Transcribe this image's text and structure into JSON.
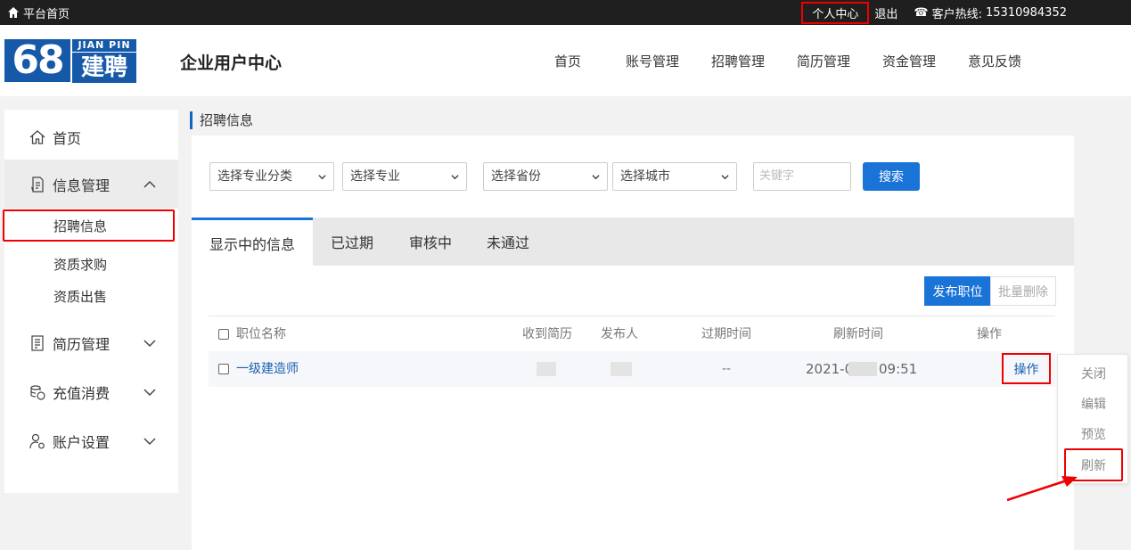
{
  "topbar": {
    "home_label": "平台首页",
    "personal_center": "个人中心",
    "logout": "退出",
    "hotline_label": "客户热线:",
    "hotline_number": "15310984352"
  },
  "header": {
    "logo_number": "68",
    "logo_en": "JIAN PIN",
    "logo_cn": "建聘",
    "title": "企业用户中心",
    "nav": [
      "首页",
      "账号管理",
      "招聘管理",
      "简历管理",
      "资金管理",
      "意见反馈"
    ]
  },
  "sidebar": {
    "home": "首页",
    "info_mgmt": "信息管理",
    "sub_items": [
      "招聘信息",
      "资质求购",
      "资质出售"
    ],
    "resume_mgmt": "简历管理",
    "recharge": "充值消费",
    "account": "账户设置"
  },
  "content": {
    "breadcrumb": "招聘信息",
    "filters": {
      "major_category": "选择专业分类",
      "major": "选择专业",
      "province": "选择省份",
      "city": "选择城市",
      "keyword_placeholder": "关键字",
      "search": "搜索"
    },
    "tabs": [
      "显示中的信息",
      "已过期",
      "审核中",
      "未通过"
    ],
    "publish": "发布职位",
    "batch_delete": "批量删除",
    "columns": [
      "职位名称",
      "收到简历",
      "发布人",
      "过期时间",
      "刷新时间",
      "操作"
    ],
    "rows": [
      {
        "title": "一级建造师",
        "expire": "--",
        "refresh_prefix": "2021-0",
        "refresh_suffix": "09:51",
        "action": "操作"
      }
    ]
  },
  "dropdown": [
    "关闭",
    "编辑",
    "预览",
    "刷新"
  ],
  "colors": {
    "accent": "#1a73d6",
    "highlight": "#e00000",
    "logo": "#1559a8"
  }
}
